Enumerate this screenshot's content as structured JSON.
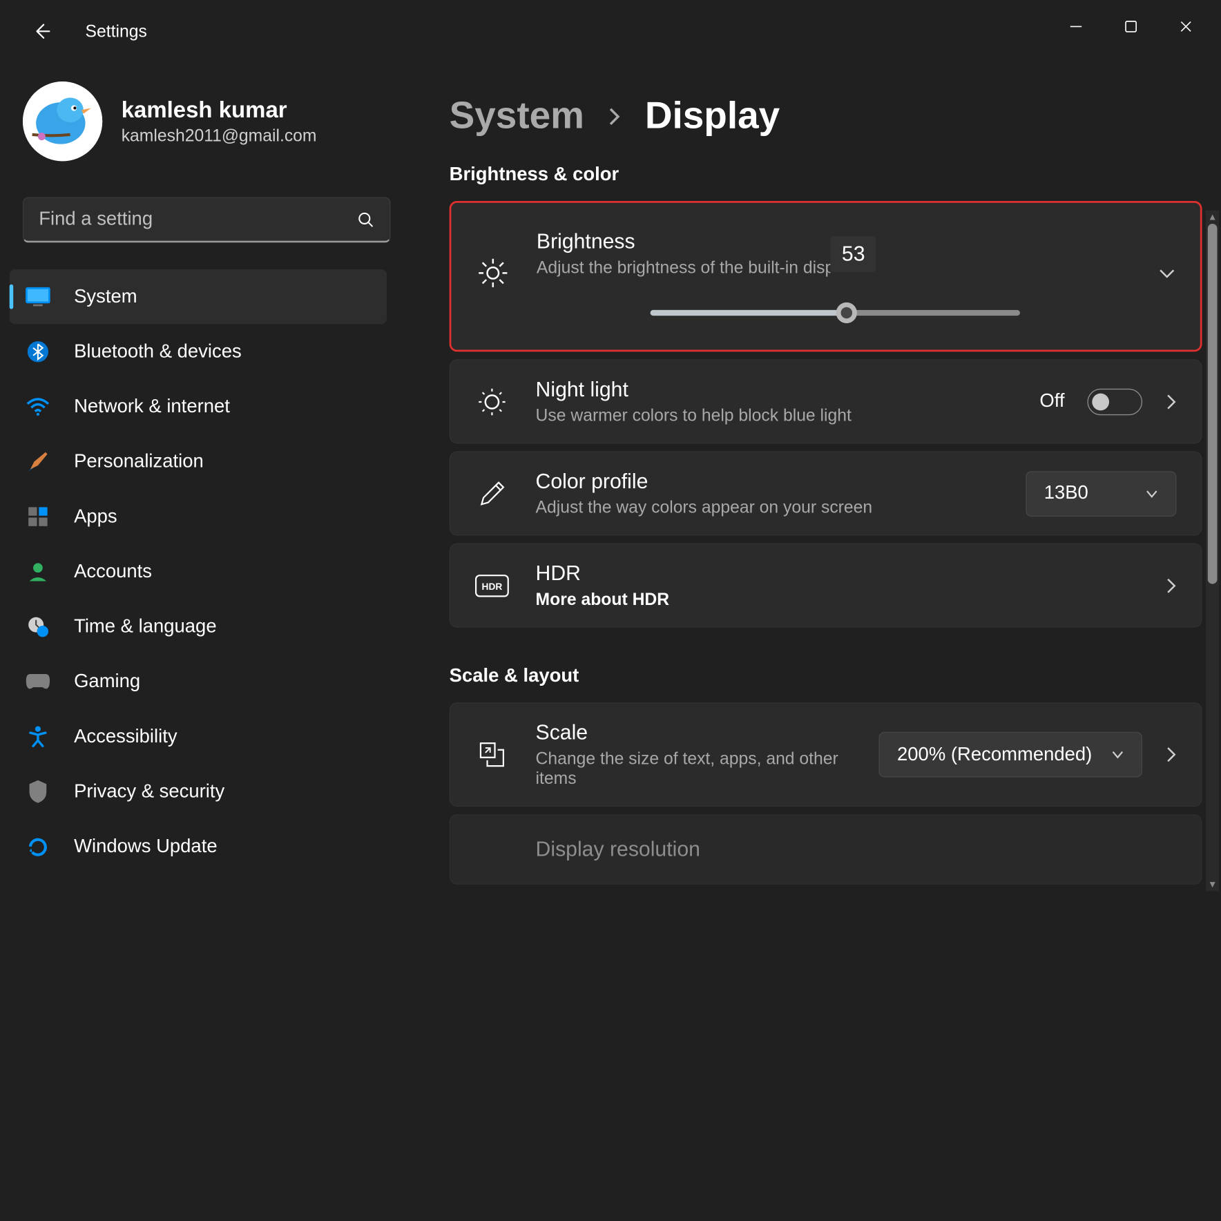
{
  "titlebar": {
    "title": "Settings"
  },
  "user": {
    "name": "kamlesh kumar",
    "email": "kamlesh2011@gmail.com"
  },
  "search": {
    "placeholder": "Find a setting"
  },
  "nav": {
    "items": [
      {
        "label": "System"
      },
      {
        "label": "Bluetooth & devices"
      },
      {
        "label": "Network & internet"
      },
      {
        "label": "Personalization"
      },
      {
        "label": "Apps"
      },
      {
        "label": "Accounts"
      },
      {
        "label": "Time & language"
      },
      {
        "label": "Gaming"
      },
      {
        "label": "Accessibility"
      },
      {
        "label": "Privacy & security"
      },
      {
        "label": "Windows Update"
      }
    ]
  },
  "breadcrumb": {
    "parent": "System",
    "current": "Display"
  },
  "sections": {
    "brightness_color": {
      "title": "Brightness & color",
      "brightness": {
        "title": "Brightness",
        "subtitle": "Adjust the brightness of the built-in display",
        "value": "53",
        "percent": 53
      },
      "night_light": {
        "title": "Night light",
        "subtitle": "Use warmer colors to help block blue light",
        "state_label": "Off"
      },
      "color_profile": {
        "title": "Color profile",
        "subtitle": "Adjust the way colors appear on your screen",
        "selected": "13B0"
      },
      "hdr": {
        "title": "HDR",
        "subtitle": "More about HDR"
      }
    },
    "scale_layout": {
      "title": "Scale & layout",
      "scale": {
        "title": "Scale",
        "subtitle": "Change the size of text, apps, and other items",
        "selected": "200% (Recommended)"
      },
      "display_resolution": {
        "title": "Display resolution"
      }
    }
  }
}
